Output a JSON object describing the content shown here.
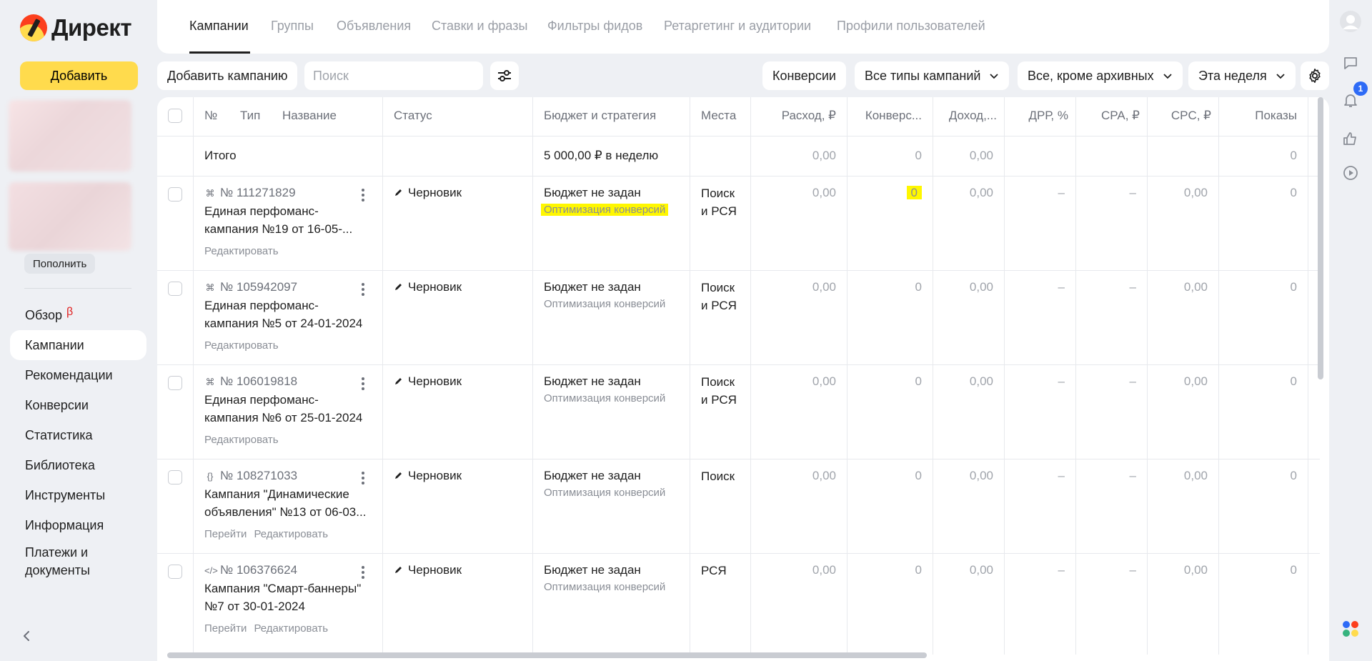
{
  "app": {
    "logo_text": "Директ"
  },
  "sidebar": {
    "add_label": "Добавить",
    "topup_label": "Пополнить",
    "items": [
      {
        "label": "Обзор",
        "badge": "β"
      },
      {
        "label": "Кампании"
      },
      {
        "label": "Рекомендации"
      },
      {
        "label": "Конверсии"
      },
      {
        "label": "Статистика"
      },
      {
        "label": "Библиотека"
      },
      {
        "label": "Инструменты"
      },
      {
        "label": "Информация"
      },
      {
        "label": "Платежи и документы"
      }
    ]
  },
  "tabs": [
    "Кампании",
    "Группы",
    "Объявления",
    "Ставки и фразы",
    "Фильтры фидов",
    "Ретаргетинг и аудитории",
    "Профили пользователей"
  ],
  "toolbar": {
    "add_campaign": "Добавить кампанию",
    "search_placeholder": "Поиск",
    "conversions": "Конверсии",
    "campaign_types": "Все типы кампаний",
    "archive_filter": "Все, кроме архивных",
    "period": "Эта неделя"
  },
  "table": {
    "headers": {
      "no": "№",
      "type": "Тип",
      "name": "Название",
      "status": "Статус",
      "budget": "Бюджет и стратегия",
      "places": "Места",
      "spend": "Расход, ₽",
      "conversions": "Конверс...",
      "income": "Доход,...",
      "drr": "ДРР, %",
      "cpa": "CPA, ₽",
      "cpc": "CPC, ₽",
      "impressions": "Показы"
    },
    "total": {
      "label": "Итого",
      "budget": "5 000,00 ₽ в неделю",
      "spend": "0,00",
      "conversions": "0",
      "income": "0,00",
      "impressions": "0"
    },
    "rows": [
      {
        "id": "№ 111271829",
        "type_icon": "smart-campaign-icon",
        "type_glyph": "⌘",
        "name1": "Единая перфоманс-",
        "name2": "кампания №19 от 16-05-...",
        "links": [
          "Редактировать"
        ],
        "status": "Черновик",
        "budget": "Бюджет не задан",
        "strategy": "Оптимизация конверсий",
        "places1": "Поиск",
        "places2": "и РСЯ",
        "spend": "0,00",
        "conversions": "0",
        "income": "0,00",
        "drr": "–",
        "cpa": "–",
        "cpc": "0,00",
        "impressions": "0"
      },
      {
        "id": "№ 105942097",
        "type_icon": "smart-campaign-icon",
        "type_glyph": "⌘",
        "name1": "Единая перфоманс-",
        "name2": "кампания №5 от 24-01-2024",
        "links": [
          "Редактировать"
        ],
        "status": "Черновик",
        "budget": "Бюджет не задан",
        "strategy": "Оптимизация конверсий",
        "places1": "Поиск",
        "places2": "и РСЯ",
        "spend": "0,00",
        "conversions": "0",
        "income": "0,00",
        "drr": "–",
        "cpa": "–",
        "cpc": "0,00",
        "impressions": "0"
      },
      {
        "id": "№ 106019818",
        "type_icon": "smart-campaign-icon",
        "type_glyph": "⌘",
        "name1": "Единая перфоманс-",
        "name2": "кампания №6 от 25-01-2024",
        "links": [
          "Редактировать"
        ],
        "status": "Черновик",
        "budget": "Бюджет не задан",
        "strategy": "Оптимизация конверсий",
        "places1": "Поиск",
        "places2": "и РСЯ",
        "spend": "0,00",
        "conversions": "0",
        "income": "0,00",
        "drr": "–",
        "cpa": "–",
        "cpc": "0,00",
        "impressions": "0"
      },
      {
        "id": "№ 108271033",
        "type_icon": "dynamic-campaign-icon",
        "type_glyph": "{}",
        "name1": "Кампания \"Динамические",
        "name2": "объявления\" №13 от 06-03...",
        "links": [
          "Перейти",
          "Редактировать"
        ],
        "status": "Черновик",
        "budget": "Бюджет не задан",
        "strategy": "Оптимизация конверсий",
        "places1": "Поиск",
        "places2": "",
        "spend": "0,00",
        "conversions": "0",
        "income": "0,00",
        "drr": "–",
        "cpa": "–",
        "cpc": "0,00",
        "impressions": "0"
      },
      {
        "id": "№ 106376624",
        "type_icon": "smart-banner-campaign-icon",
        "type_glyph": "</>",
        "name1": "Кампания \"Смарт-баннеры\"",
        "name2": "№7 от 30-01-2024",
        "links": [
          "Перейти",
          "Редактировать"
        ],
        "status": "Черновик",
        "budget": "Бюджет не задан",
        "strategy": "Оптимизация конверсий",
        "places1": "РСЯ",
        "places2": "",
        "spend": "0,00",
        "conversions": "0",
        "income": "0,00",
        "drr": "–",
        "cpa": "–",
        "cpc": "0,00",
        "impressions": "0"
      }
    ]
  },
  "notifications": {
    "count": "1"
  },
  "colors": {
    "accent": "#ffdb4d",
    "highlight": "#fff700",
    "badge": "#2e6bf6"
  }
}
